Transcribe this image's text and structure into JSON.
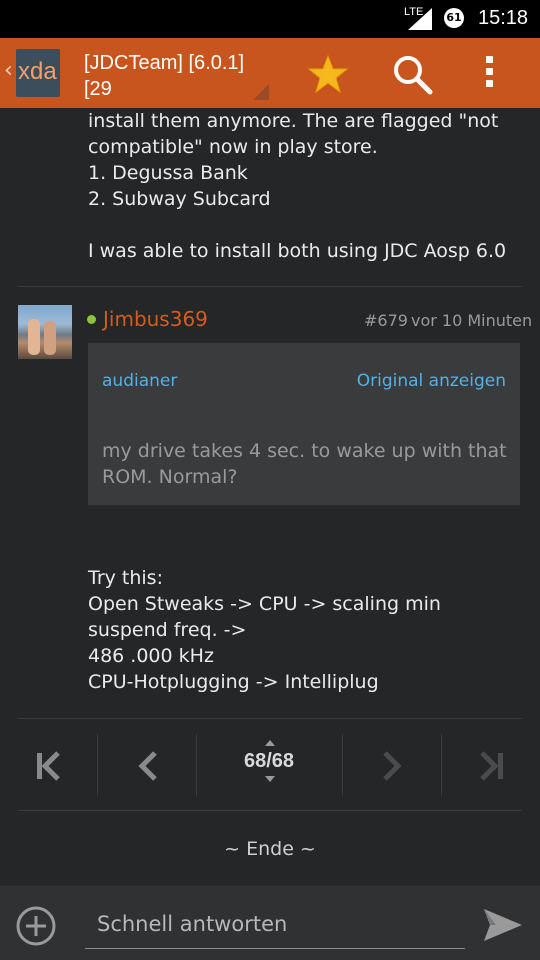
{
  "status_bar": {
    "network": "LTE",
    "battery": "61",
    "time": "15:18"
  },
  "app_bar": {
    "logo_text": "xda",
    "thread_title": "[JDCTeam] [6.0.1][29",
    "icons": [
      "back-chevron-icon",
      "star-icon",
      "search-icon",
      "overflow-menu-icon"
    ],
    "star_color": "#f5b81e",
    "bar_color": "#c7551d"
  },
  "previous_post": {
    "lines": [
      "install them anymore. The are flagged \"not",
      "compatible\" now in play store.",
      "1. Degussa Bank",
      "2. Subway Subcard",
      "",
      "I was able to install both using JDC Aosp 6.0"
    ]
  },
  "post": {
    "username": "Jimbus369",
    "post_number": "#679",
    "time_ago": "vor 10 Minuten",
    "online_color": "#8cc43c",
    "quote": {
      "author": "audianer",
      "original_link": "Original anzeigen",
      "text": "my drive takes 4 sec. to wake up with that ROM. Normal?"
    },
    "body_lines": [
      "Try this:",
      "Open Stweaks -> CPU -> scaling min",
      "suspend freq. ->",
      "486 .000 kHz",
      "CPU-Hotplugging -> Intelliplug"
    ]
  },
  "pagination": {
    "current_page": "68/68",
    "buttons": [
      "first-page-icon",
      "previous-page-icon",
      "next-page-icon",
      "last-page-icon"
    ]
  },
  "end_marker": "~ Ende ~",
  "reply_bar": {
    "placeholder": "Schnell antworten",
    "icons": [
      "add-circle-icon",
      "send-icon"
    ]
  }
}
